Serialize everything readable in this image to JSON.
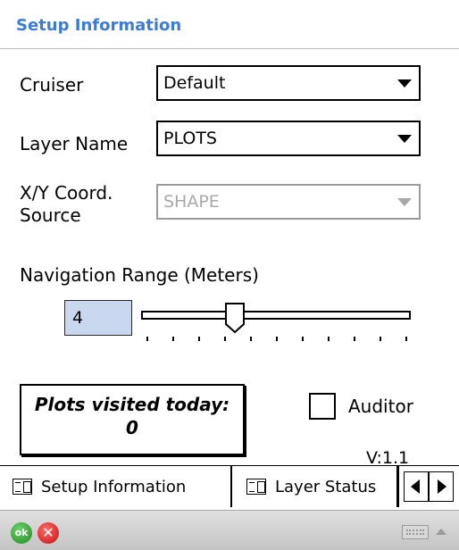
{
  "header": {
    "title": "Setup Information"
  },
  "fields": {
    "cruiser": {
      "label": "Cruiser",
      "value": "Default"
    },
    "layer": {
      "label": "Layer Name",
      "value": "PLOTS"
    },
    "coord": {
      "label_line1": "X/Y Coord.",
      "label_line2": "Source",
      "value": "SHAPE",
      "enabled": false
    }
  },
  "navigation": {
    "label": "Navigation Range (Meters)",
    "value": "4",
    "slider_position_fraction": 0.34,
    "tick_count": 11
  },
  "plots_visited": {
    "line1": "Plots visited today:",
    "count": "0"
  },
  "auditor": {
    "label": "Auditor",
    "checked": false
  },
  "version": "V:1.1",
  "tabs": [
    {
      "label": "Setup Information",
      "active": true
    },
    {
      "label": "Layer Status",
      "active": false
    }
  ],
  "bottombar": {
    "ok_label": "ok",
    "cancel_label": "✕",
    "icons": [
      "ok-icon",
      "cancel-icon",
      "keyboard-icon",
      "up-arrow-icon"
    ]
  },
  "colors": {
    "title": "#3c7bd8",
    "input_bg": "#c9d7ef",
    "ok": "#1e8a1e",
    "cancel": "#c41010"
  }
}
